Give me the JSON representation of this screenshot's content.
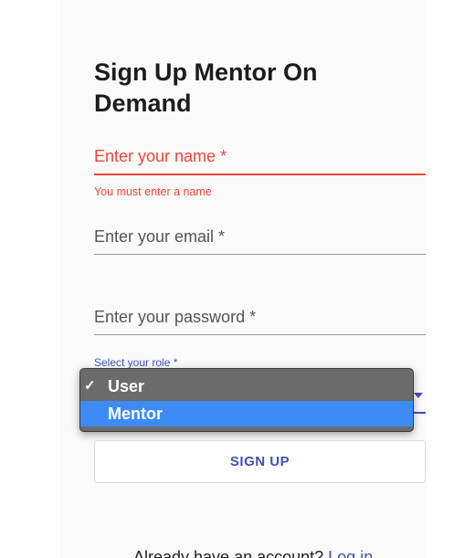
{
  "header": {
    "title": "Sign Up Mentor On Demand"
  },
  "form": {
    "name": {
      "placeholder": "Enter your name *",
      "error": "You must enter a name"
    },
    "email": {
      "placeholder": "Enter your email *"
    },
    "password": {
      "placeholder": "Enter your password *"
    },
    "role": {
      "label": "Select your role *",
      "options": [
        {
          "label": "User",
          "selected": true
        },
        {
          "label": "Mentor",
          "highlighted": true
        }
      ],
      "check_glyph": "✓"
    },
    "submit_label": "SIGN UP"
  },
  "footer": {
    "prompt": "Already have an account? ",
    "login_link": "Log in"
  },
  "colors": {
    "accent": "#3f51b5",
    "error": "#f44336",
    "highlight": "#3d8bf5"
  },
  "icons": {
    "checkmark": "checkmark-icon",
    "caret": "caret-down-icon"
  }
}
